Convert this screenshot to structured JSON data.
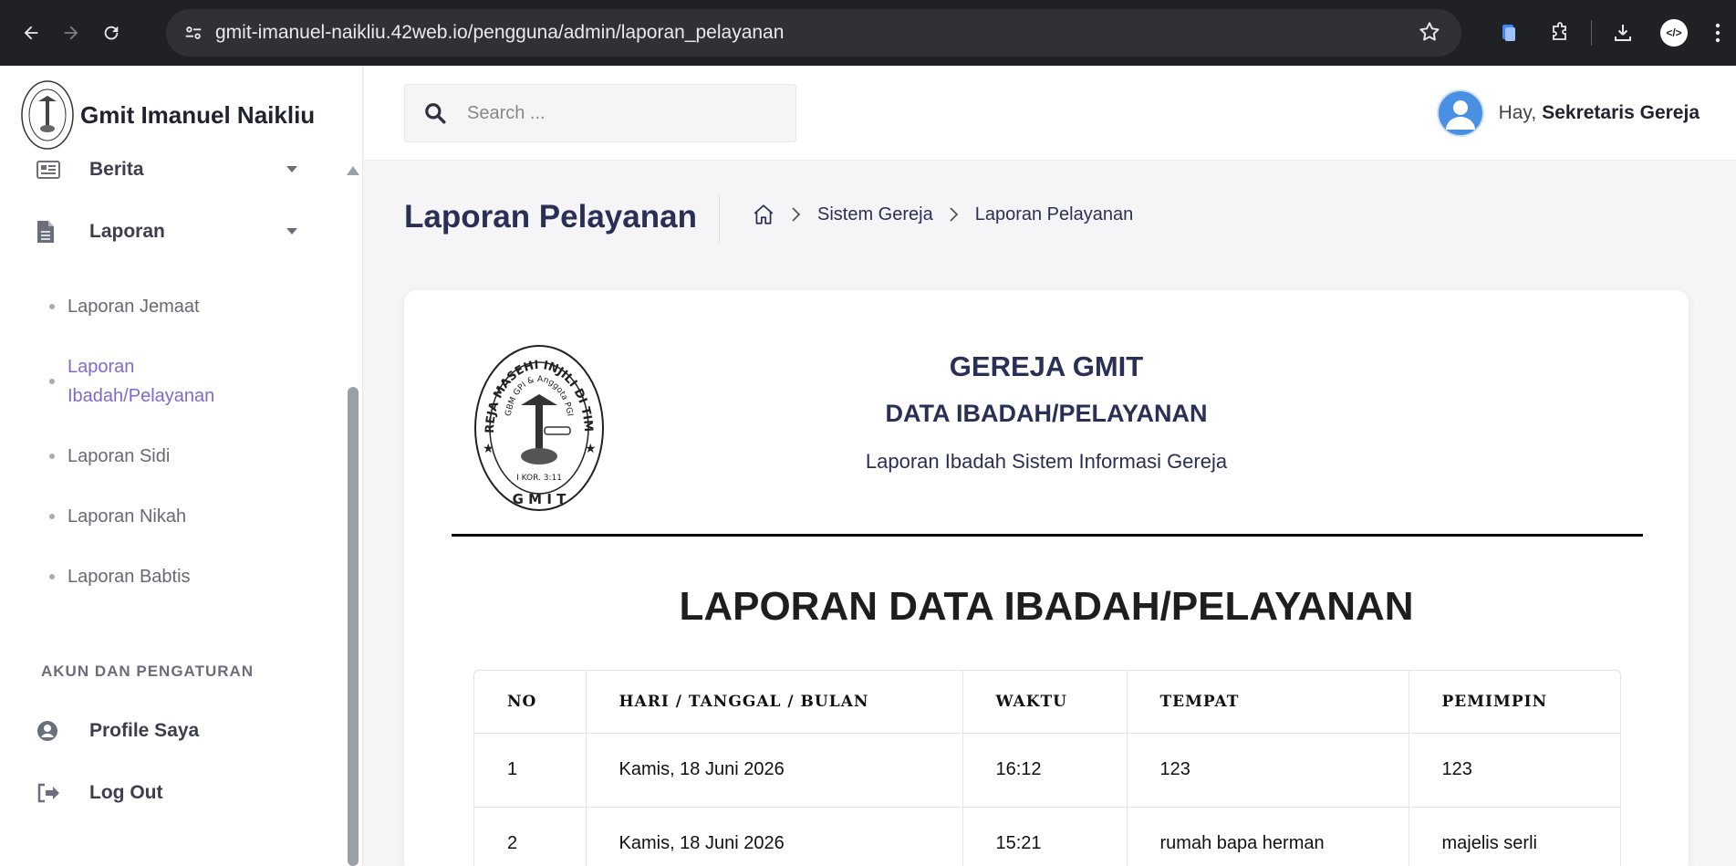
{
  "browser": {
    "url": "gmit-imanuel-naikliu.42web.io/pengguna/admin/laporan_pelayanan",
    "profile_label": "</>"
  },
  "sidebar": {
    "brand": "Gmit Imanuel Naikliu",
    "menu": [
      {
        "label": "Berita",
        "icon": "newspaper-icon"
      },
      {
        "label": "Laporan",
        "icon": "file-icon"
      }
    ],
    "submenu": [
      {
        "label": "Laporan Jemaat"
      },
      {
        "label": "Laporan Ibadah/Pelayanan"
      },
      {
        "label": "Laporan Sidi"
      },
      {
        "label": "Laporan Nikah"
      },
      {
        "label": "Laporan Babtis"
      }
    ],
    "section_title": "AKUN DAN PENGATURAN",
    "account": [
      {
        "label": "Profile Saya",
        "icon": "user-circle-icon"
      },
      {
        "label": "Log Out",
        "icon": "logout-icon"
      }
    ]
  },
  "header": {
    "search_placeholder": "Search ...",
    "greeting": "Hay,",
    "user_name": "Sekretaris Gereja"
  },
  "page": {
    "title": "Laporan Pelayanan",
    "breadcrumb": [
      "Sistem Gereja",
      "Laporan Pelayanan"
    ]
  },
  "report": {
    "heading1": "GEREJA GMIT",
    "heading2": "DATA IBADAH/PELAYANAN",
    "heading3": "Laporan Ibadah Sistem Informasi Gereja",
    "title": "LAPORAN DATA IBADAH/PELAYANAN",
    "logo": {
      "ring_text": "GEREJA MASEHI INJILI DI TIMOR",
      "inner_text": "GBM GPI & Anggota PGI",
      "verse": "I KOR. 3:11",
      "bottom": "G M I T"
    },
    "columns": [
      "NO",
      "HARI / TANGGAL / BULAN",
      "WAKTU",
      "TEMPAT",
      "PEMIMPIN"
    ],
    "rows": [
      [
        "1",
        "Kamis, 18 Juni 2026",
        "16:12",
        "123",
        "123"
      ],
      [
        "2",
        "Kamis, 18 Juni 2026",
        "15:21",
        "rumah bapa herman",
        "majelis serli"
      ]
    ]
  }
}
